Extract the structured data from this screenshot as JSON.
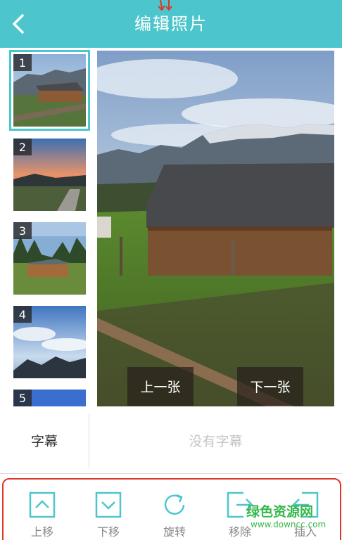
{
  "header": {
    "title": "编辑照片",
    "background_color": "#4cc6cc",
    "back_icon": "chevron-left-icon"
  },
  "thumbnails": [
    {
      "number": "1",
      "selected": true
    },
    {
      "number": "2",
      "selected": false
    },
    {
      "number": "3",
      "selected": false
    },
    {
      "number": "4",
      "selected": false
    },
    {
      "number": "5",
      "selected": false
    }
  ],
  "photo": {
    "prev_label": "上一张",
    "next_label": "下一张"
  },
  "caption": {
    "label": "字幕",
    "placeholder": "没有字幕"
  },
  "toolbar": {
    "items": [
      {
        "label": "上移",
        "icon": "move-up-icon"
      },
      {
        "label": "下移",
        "icon": "move-down-icon"
      },
      {
        "label": "旋转",
        "icon": "rotate-icon"
      },
      {
        "label": "移除",
        "icon": "remove-icon"
      },
      {
        "label": "插入",
        "icon": "insert-icon"
      }
    ],
    "icon_color": "#4cc6cc",
    "highlight_color": "#e0352b"
  },
  "watermark": {
    "name": "绿色资源网",
    "url": "www.downcc.com"
  }
}
